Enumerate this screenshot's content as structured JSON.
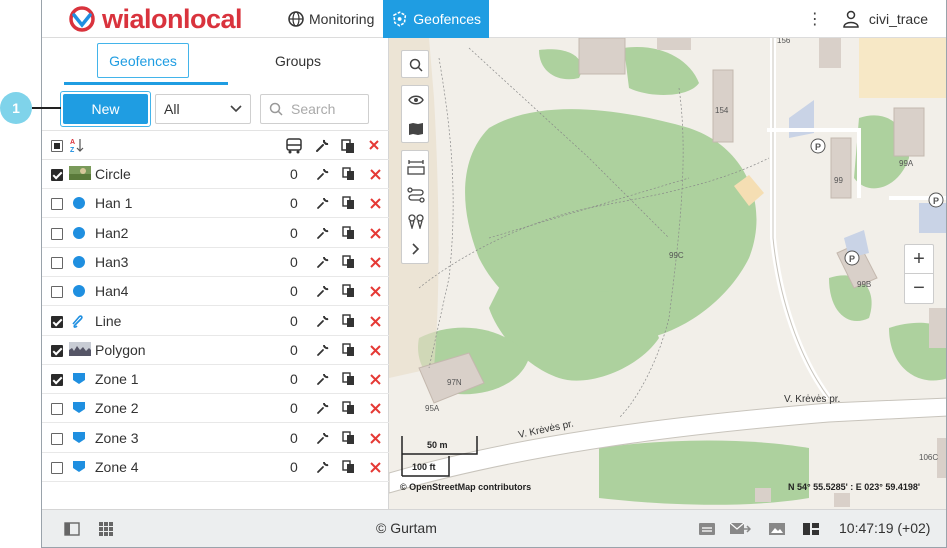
{
  "callout": {
    "number": "1"
  },
  "header": {
    "logo_text_a": "wialon",
    "logo_text_b": "local",
    "nav": [
      {
        "label": "Monitoring",
        "icon": "globe-icon"
      },
      {
        "label": "Geofences",
        "icon": "geofence-icon"
      }
    ],
    "user_name": "civi_trace"
  },
  "panel": {
    "tabs": [
      "Geofences",
      "Groups"
    ],
    "new_label": "New",
    "filter_selected": "All",
    "search_placeholder": "Search",
    "rows": [
      {
        "name": "Circle",
        "count": "0",
        "checked": true,
        "icon": "circle-image-icon"
      },
      {
        "name": "Han 1",
        "count": "0",
        "checked": false,
        "icon": "dot-icon"
      },
      {
        "name": "Han2",
        "count": "0",
        "checked": false,
        "icon": "dot-icon"
      },
      {
        "name": "Han3",
        "count": "0",
        "checked": false,
        "icon": "dot-icon"
      },
      {
        "name": "Han4",
        "count": "0",
        "checked": false,
        "icon": "dot-icon"
      },
      {
        "name": "Line",
        "count": "0",
        "checked": true,
        "icon": "line-icon"
      },
      {
        "name": "Polygon",
        "count": "0",
        "checked": true,
        "icon": "polygon-image-icon"
      },
      {
        "name": "Zone 1",
        "count": "0",
        "checked": true,
        "icon": "zone-icon"
      },
      {
        "name": "Zone 2",
        "count": "0",
        "checked": false,
        "icon": "zone-icon"
      },
      {
        "name": "Zone 3",
        "count": "0",
        "checked": false,
        "icon": "zone-icon"
      },
      {
        "name": "Zone 4",
        "count": "0",
        "checked": false,
        "icon": "zone-icon"
      }
    ]
  },
  "map": {
    "labels": {
      "b156": "156",
      "b154": "154",
      "b99": "99",
      "b99a": "99A",
      "b99b": "99B",
      "b99c": "99C",
      "b97n": "97N",
      "b95a": "95A",
      "b106c": "106C",
      "street1": "V. Krėvės pr.",
      "street2": "V. Krėvės pr."
    },
    "scale_m": "50 m",
    "scale_ft": "100 ft",
    "attribution": "© OpenStreetMap contributors",
    "coordinates": "N 54° 55.5285' : E 023° 59.4198'"
  },
  "footer": {
    "copyright": "© Gurtam",
    "time": "10:47:19 (+02)"
  }
}
